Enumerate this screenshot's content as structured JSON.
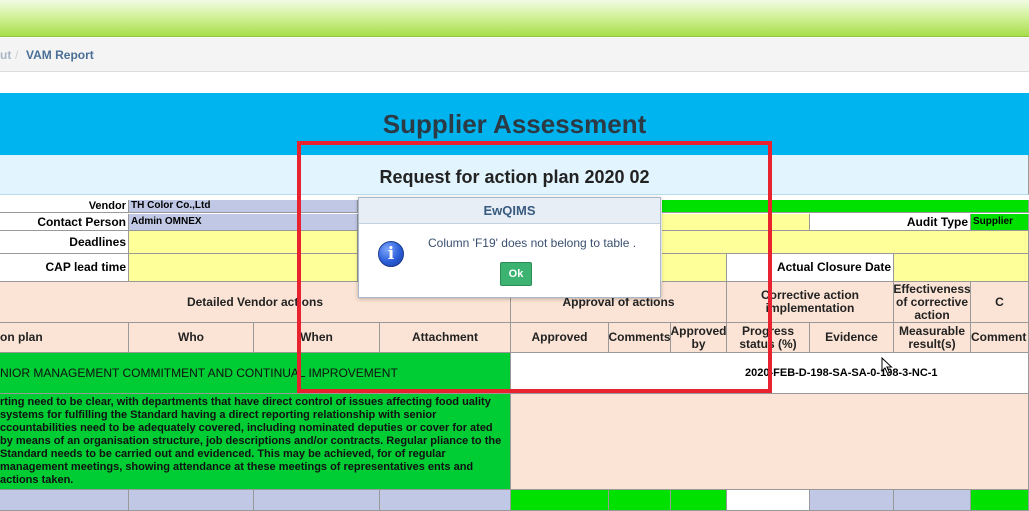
{
  "breadcrumb": {
    "prev": "ut",
    "separator": "/",
    "current": "VAM Report"
  },
  "report": {
    "title": "Supplier Assessment",
    "subtitle": "Request for action plan 2020 02",
    "vendor_label": "Vendor",
    "vendor_value": "TH Color Co.,Ltd",
    "contact_label": "Contact Person",
    "contact_value": "Admin OMNEX",
    "deadlines_label": "Deadlines",
    "cap_lead_label": "CAP lead time",
    "audit_type_label": "Audit Type",
    "audit_type_value": "Supplier As",
    "actual_closure_label": "Actual Closure Date",
    "headers": {
      "detailed_vendor_actions": "Detailed Vendor actions",
      "approval_of_actions": "Approval of actions",
      "corrective_impl": "Corrective action implementation",
      "effectiveness": "Effectiveness of corrective action",
      "c_partial": "C",
      "action_plan": "on plan",
      "who": "Who",
      "when": "When",
      "attachment": "Attachment",
      "approved": "Approved",
      "comments": "Comments",
      "approved_by": "Approved by",
      "progress_status": "Progress status (%)",
      "evidence": "Evidence",
      "measurable": "Measurable result(s)",
      "comments_partial": "Comment"
    },
    "requirement_title": "NIOR MANAGEMENT COMMITMENT AND CONTINUAL IMPROVEMENT",
    "nc_reference": "2020-FEB-D-198-SA-SA-0-198-3-NC-1",
    "requirement_text": "rting need to be clear, with departments that have direct control of issues affecting food uality systems for fulfilling the Standard having a direct reporting relationship with senior ccountabilities need to be adequately covered, including nominated deputies or cover for ated by means of an organisation structure, job descriptions and/or contracts. Regular pliance to the Standard needs to be carried out and evidenced. This may be achieved, for of regular management meetings, showing attendance at these meetings of representatives ents and actions taken."
  },
  "dialog": {
    "title": "EwQIMS",
    "message": "Column 'F19' does not belong to table .",
    "ok_label": "Ok",
    "icon": "info-icon"
  },
  "colors": {
    "title_band": "#00b4f0",
    "green": "#00e100",
    "highlight": "#e8232f",
    "ok_button": "#3cb371"
  }
}
